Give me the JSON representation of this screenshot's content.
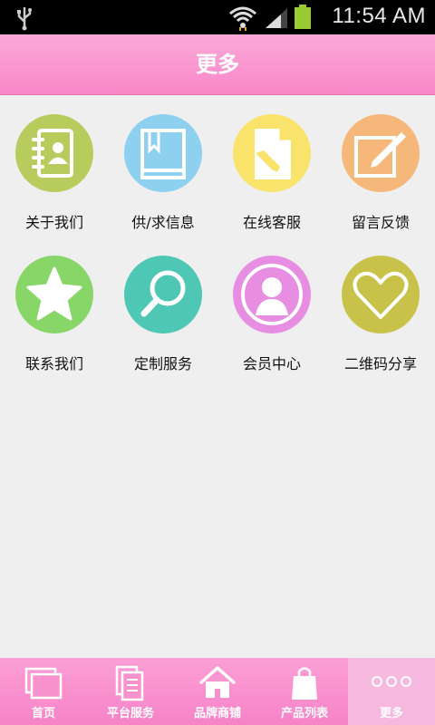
{
  "status": {
    "time": "11:54 AM"
  },
  "header": {
    "title": "更多"
  },
  "grid": [
    {
      "label": "关于我们",
      "icon": "contacts-book-icon",
      "color": "#b8cc5e"
    },
    {
      "label": "供/求信息",
      "icon": "bookmark-book-icon",
      "color": "#8dd0f0"
    },
    {
      "label": "在线客服",
      "icon": "document-pencil-icon",
      "color": "#f9e36a"
    },
    {
      "label": "留言反馈",
      "icon": "edit-note-icon",
      "color": "#f5b77a"
    },
    {
      "label": "联系我们",
      "icon": "star-icon",
      "color": "#88d668"
    },
    {
      "label": "定制服务",
      "icon": "search-icon",
      "color": "#4ec7b5"
    },
    {
      "label": "会员中心",
      "icon": "user-profile-icon",
      "color": "#e88ee2"
    },
    {
      "label": "二维码分享",
      "icon": "heart-icon",
      "color": "#c9c24a"
    }
  ],
  "tabs": [
    {
      "label": "首页",
      "icon": "windows-icon"
    },
    {
      "label": "平台服务",
      "icon": "documents-icon"
    },
    {
      "label": "品牌商铺",
      "icon": "home-icon"
    },
    {
      "label": "产品列表",
      "icon": "shopping-bag-icon"
    },
    {
      "label": "更多",
      "icon": "more-dots-icon",
      "active": true
    }
  ]
}
